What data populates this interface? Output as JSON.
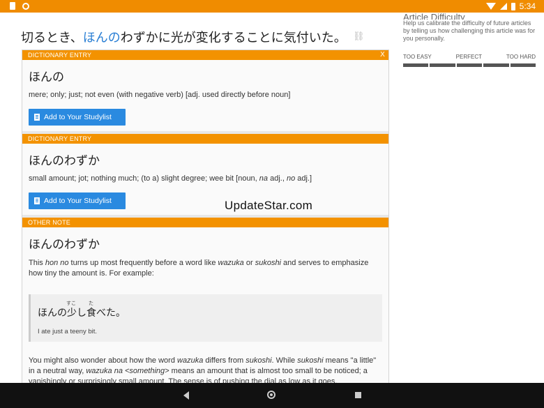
{
  "status_bar": {
    "time": "5:34"
  },
  "side_panel": {
    "title": "Article Difficulty",
    "description": "Help us calibrate the difficulty of future articles by telling us how challenging this article was for you personally.",
    "labels": [
      "TOO EASY",
      "PERFECT",
      "TOO HARD"
    ],
    "segments": 5
  },
  "sentence": {
    "before": "切るとき、",
    "highlight": "ほんの",
    "after": "わずかに光が変化することに気付いた。"
  },
  "popup": {
    "close_label": "X",
    "entries": [
      {
        "header": "DICTIONARY ENTRY",
        "word": "ほんの",
        "definition": "mere; only; just; not even (with negative verb) [adj. used directly before noun]",
        "button_label": "Add to Your Studylist"
      },
      {
        "header": "DICTIONARY ENTRY",
        "word": "ほんのわずか",
        "definition_parts": [
          "small amount; jot; nothing much; (to a) slight degree; wee bit [noun, ",
          "na",
          " adj., ",
          "no",
          " adj.]"
        ],
        "button_label": "Add to Your Studylist"
      }
    ],
    "note": {
      "header": "OTHER NOTE",
      "word": "ほんのわずか",
      "intro_parts": [
        "This ",
        "hon no",
        " turns up most frequently before a word like ",
        "wazuka",
        " or ",
        "sukoshi",
        " and serves to emphasize how tiny the amount is. For example:"
      ],
      "example_jp": [
        "ほんの",
        "少",
        "し",
        "食",
        "べた。"
      ],
      "furigana": [
        "すこ",
        "た"
      ],
      "example_en": "I ate just a teeny bit.",
      "outro_parts": [
        "You might also wonder about how the word ",
        "wazuka",
        " differs from ",
        "sukoshi",
        ". While ",
        "sukoshi",
        " means \"a little\" in a neutral way, ",
        "wazuka na <something>",
        " means an amount that is almost too small to be noticed; a vanishingly or surprisingly small amount. The sense is of pushing the dial as low as it goes."
      ]
    }
  },
  "watermark": "UpdateStar.com"
}
